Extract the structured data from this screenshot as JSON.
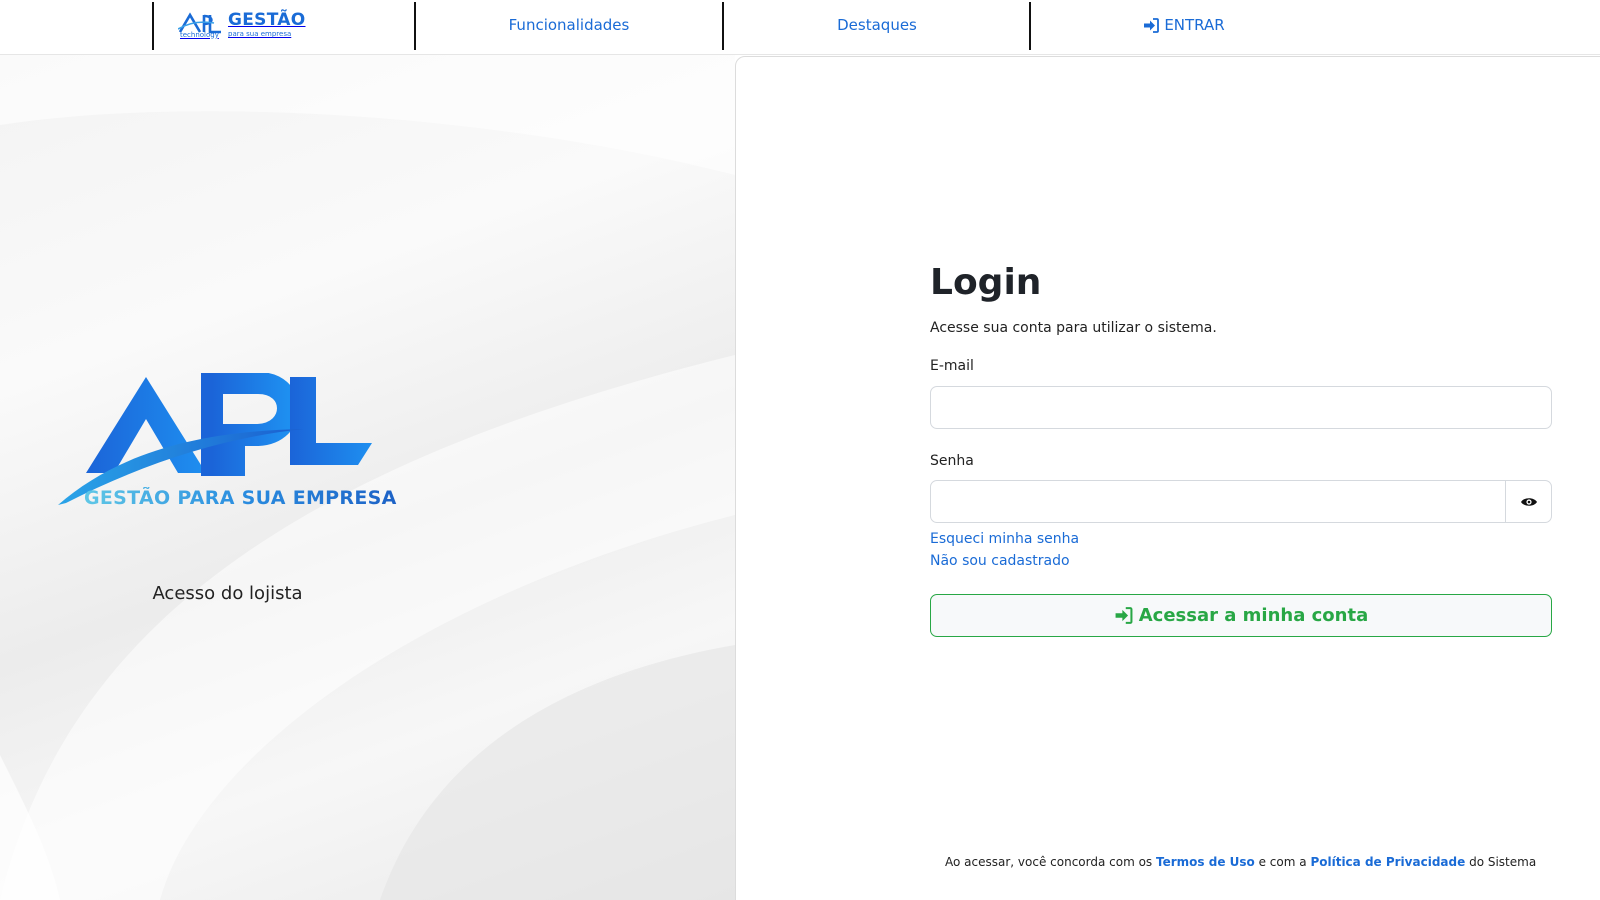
{
  "navbar": {
    "brand": {
      "mini_logo_text": "APL",
      "mini_logo_sub": "technology",
      "title": "GESTÃO",
      "subtitle": "para sua empresa"
    },
    "items": [
      {
        "label": "Funcionalidades"
      },
      {
        "label": "Destaques"
      },
      {
        "label": "ENTRAR",
        "icon": "sign-in-icon"
      }
    ]
  },
  "left_panel": {
    "logo_text": "APL",
    "tagline": "GESTÃO PARA SUA EMPRESA",
    "caption": "Acesso do lojista"
  },
  "login": {
    "title": "Login",
    "subtitle": "Acesse sua conta para utilizar o sistema.",
    "email": {
      "label": "E-mail",
      "value": "",
      "placeholder": ""
    },
    "password": {
      "label": "Senha",
      "value": "",
      "placeholder": "",
      "toggle_icon": "eye-icon"
    },
    "forgot_link": "Esqueci minha senha",
    "register_link": "Não sou cadastrado",
    "submit": {
      "label": "Acessar a minha conta",
      "icon": "sign-in-icon"
    }
  },
  "footer": {
    "text_1": "Ao acessar, você concorda com os",
    "terms_link": "Termos de Uso",
    "text_2": "e com a",
    "privacy_link": "Política de Privacidade",
    "text_3": "do Sistema"
  },
  "colors": {
    "link_blue": "#1a6bd6",
    "success_green": "#28a745",
    "logo_blue": "#1d6fe0"
  }
}
